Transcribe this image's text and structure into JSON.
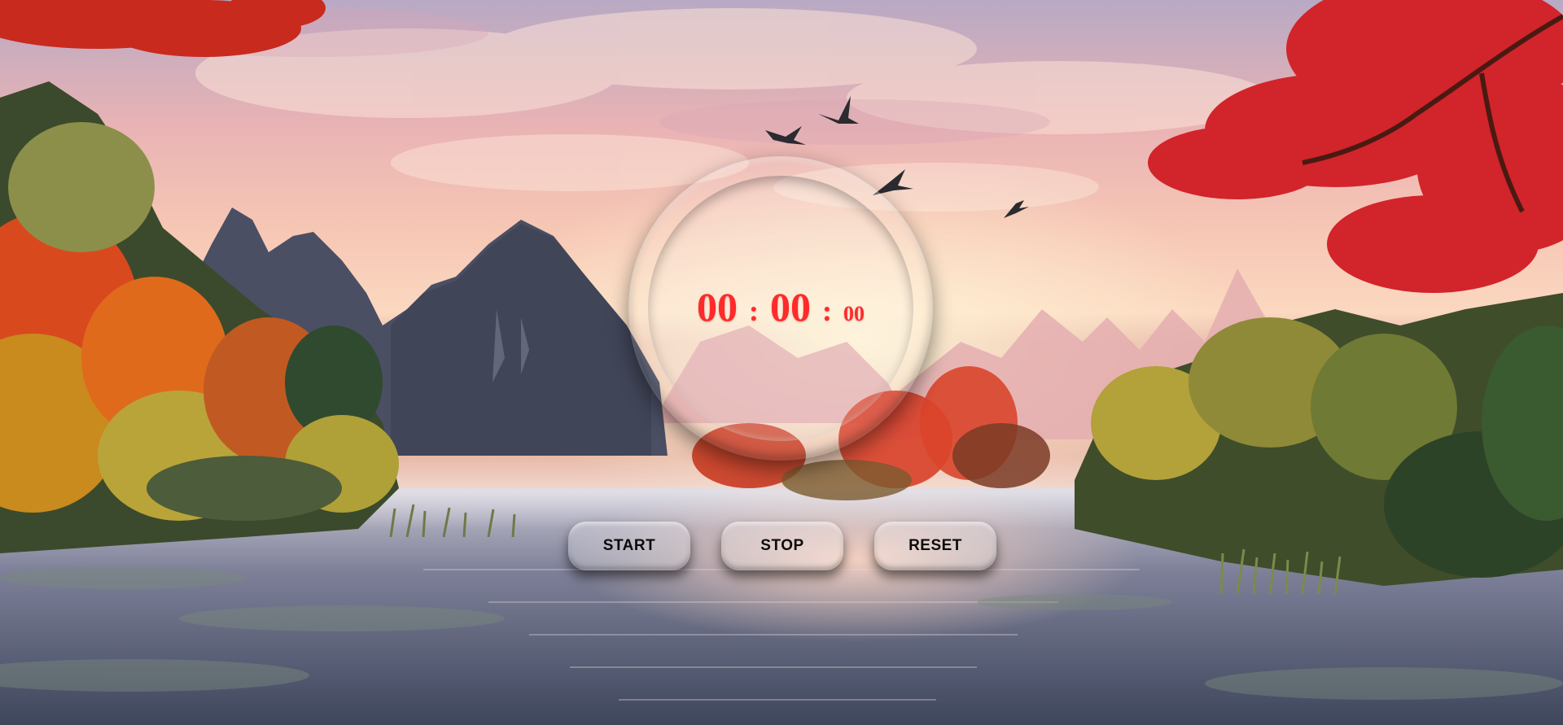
{
  "timer": {
    "minutes": "00",
    "seconds": "00",
    "centiseconds": "00",
    "separator": ":"
  },
  "controls": {
    "start_label": "START",
    "stop_label": "STOP",
    "reset_label": "RESET"
  },
  "colors": {
    "timer_digits": "#ff2a2a",
    "button_text": "#0b0b0b"
  }
}
